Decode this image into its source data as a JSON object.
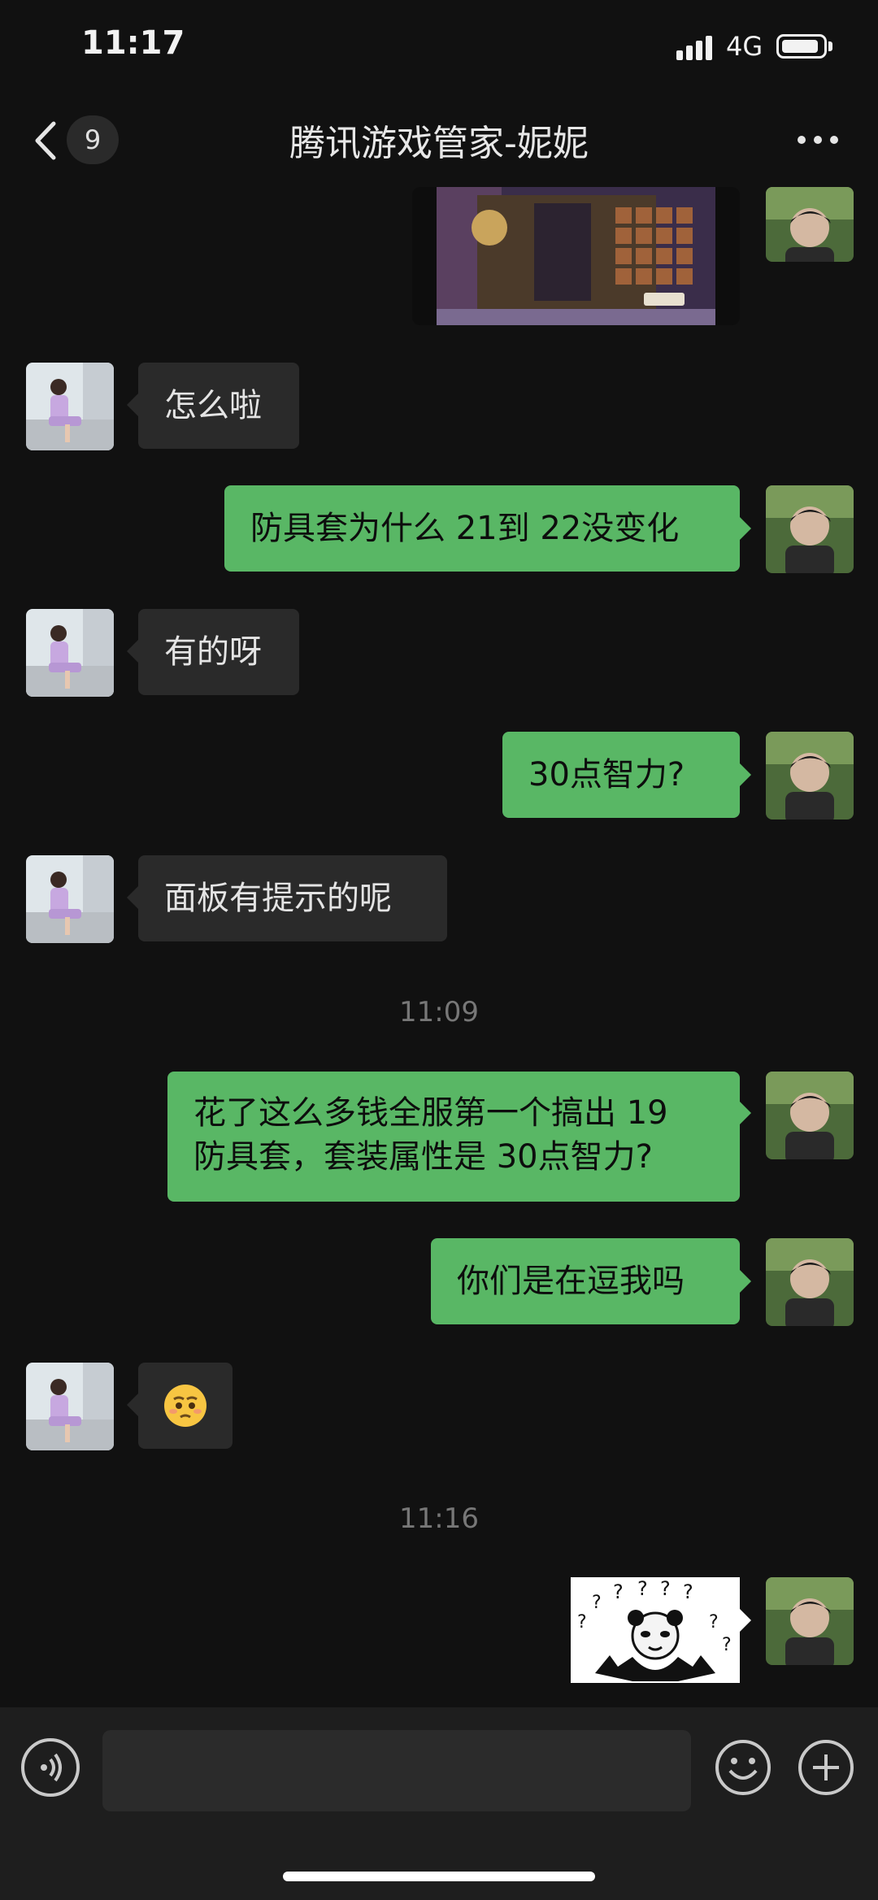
{
  "status_bar": {
    "time": "11:17",
    "network": "4G"
  },
  "header": {
    "unread_count": "9",
    "title": "腾讯游戏管家-妮妮"
  },
  "messages": [
    {
      "side": "out",
      "kind": "image",
      "desc": "game-screenshot"
    },
    {
      "side": "in",
      "text": "怎么啦"
    },
    {
      "side": "out",
      "text": "防具套为什么 21到 22没变化"
    },
    {
      "side": "in",
      "text": "有的呀"
    },
    {
      "side": "out",
      "text": "30点智力?"
    },
    {
      "side": "in",
      "text": "面板有提示的呢"
    },
    {
      "timestamp": "11:09"
    },
    {
      "side": "out",
      "text_lines": [
        "花了这么多钱全服第一个搞出 19",
        "防具套，套装属性是 30点智力?"
      ]
    },
    {
      "side": "out",
      "text": "你们是在逗我吗"
    },
    {
      "side": "in",
      "kind": "emoji",
      "emoji": "🥺"
    },
    {
      "timestamp": "11:16"
    },
    {
      "side": "out",
      "kind": "sticker",
      "sticker_text": "? ? ? ? ? ? ? ?"
    }
  ],
  "colors": {
    "bg": "#111111",
    "incoming_bubble": "#2a2a2a",
    "outgoing_bubble": "#59b765"
  },
  "input_bar": {
    "value": "",
    "icons": [
      "voice-icon",
      "emoji-icon",
      "plus-icon"
    ]
  }
}
